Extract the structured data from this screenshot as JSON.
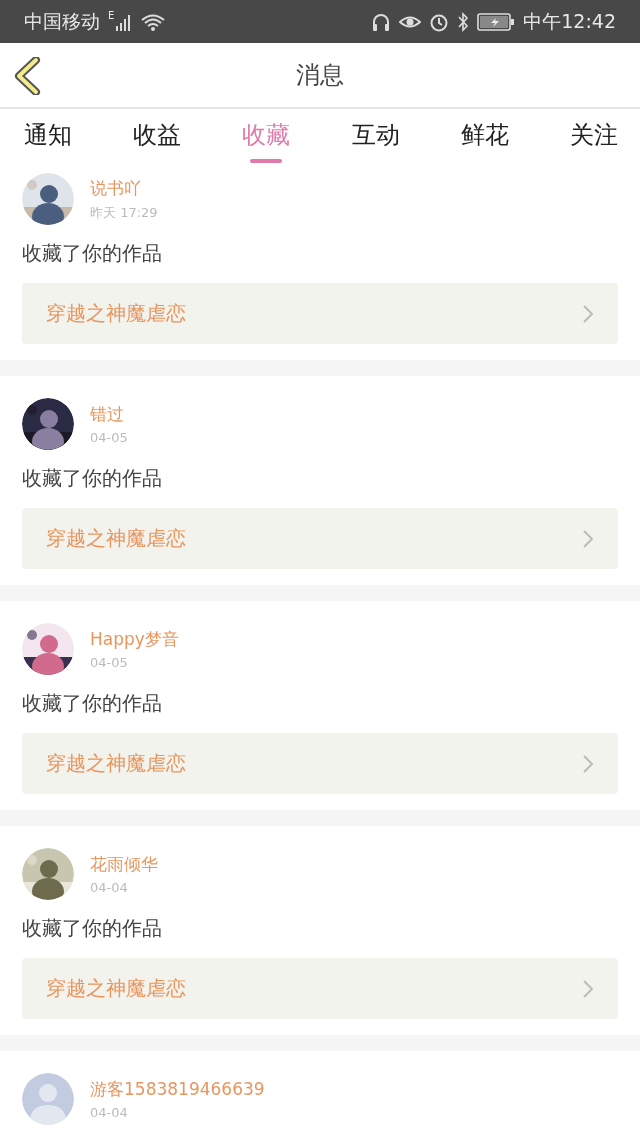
{
  "status_bar": {
    "carrier": "中国移动",
    "network": "E",
    "time": "中午12:42"
  },
  "header": {
    "title": "消息"
  },
  "tabs": [
    {
      "label": "通知",
      "selected": false
    },
    {
      "label": "收益",
      "selected": false
    },
    {
      "label": "收藏",
      "selected": true
    },
    {
      "label": "互动",
      "selected": false
    },
    {
      "label": "鲜花",
      "selected": false
    },
    {
      "label": "关注",
      "selected": false
    }
  ],
  "messages": [
    {
      "name": "说书吖",
      "time": "昨天  17:29",
      "action": "收藏了你的作品",
      "work": "穿越之神魔虐恋"
    },
    {
      "name": "错过",
      "time": "04-05",
      "action": "收藏了你的作品",
      "work": "穿越之神魔虐恋"
    },
    {
      "name": "Happy梦音",
      "time": "04-05",
      "action": "收藏了你的作品",
      "work": "穿越之神魔虐恋"
    },
    {
      "name": "花雨倾华",
      "time": "04-04",
      "action": "收藏了你的作品",
      "work": "穿越之神魔虐恋"
    },
    {
      "avatar": {
        "kind": "default"
      },
      "name": "游客1583819466639",
      "time": "04-04"
    }
  ]
}
